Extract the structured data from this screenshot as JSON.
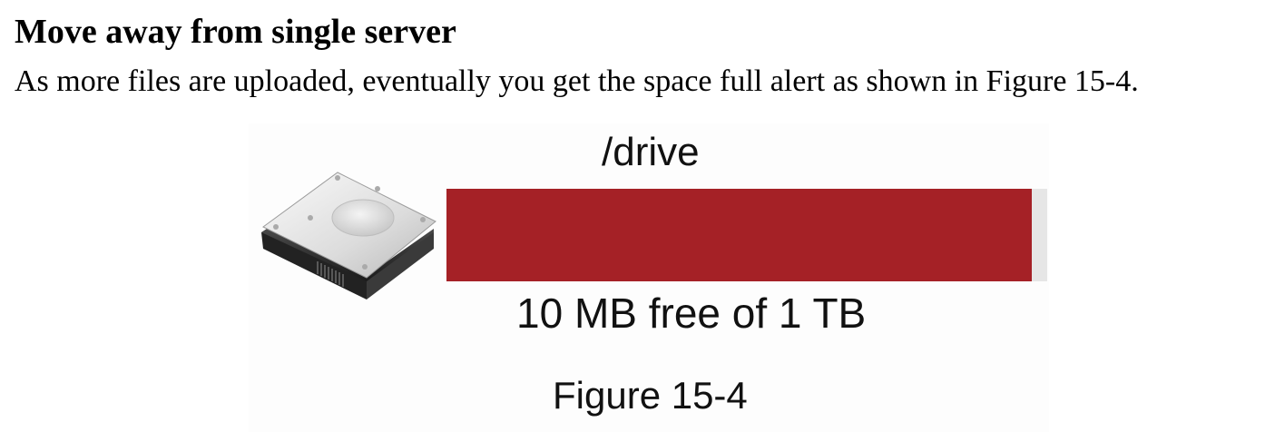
{
  "heading": "Move away from single server",
  "body": "As more files are uploaded, eventually you get the space full alert as shown in Figure 15-4.",
  "figure": {
    "drive_label": "/drive",
    "free_label": "10 MB free of 1 TB",
    "caption": "Figure 15-4",
    "disk_icon": "hard-drive-icon",
    "used_fraction": 0.975,
    "colors": {
      "used": "#a52126",
      "free": "#e6e6e6"
    }
  }
}
